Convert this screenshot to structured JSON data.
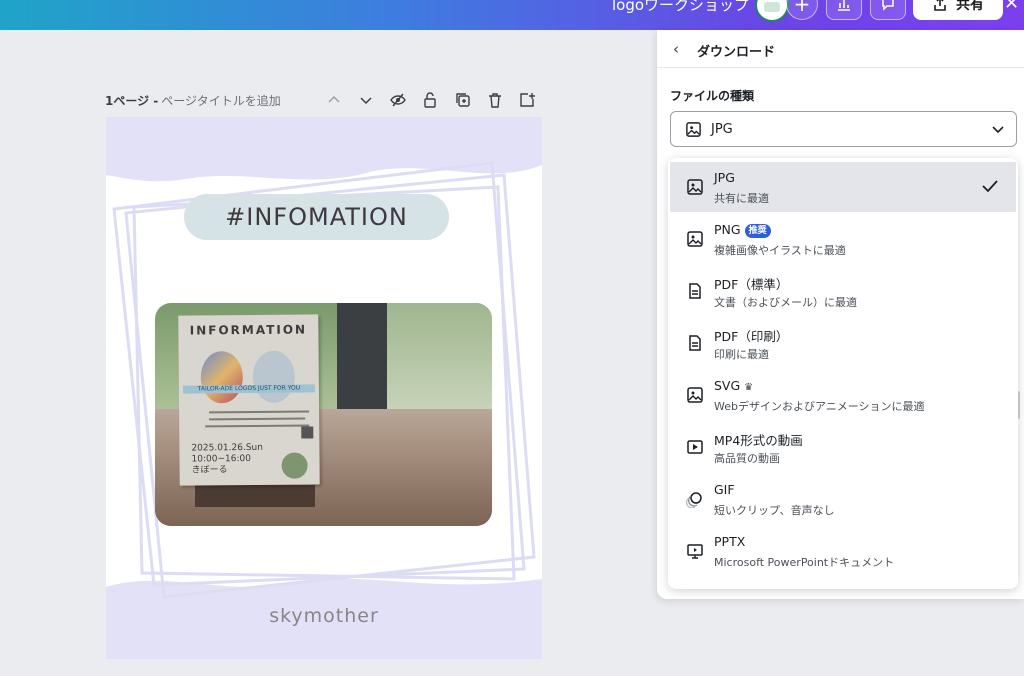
{
  "topbar": {
    "project_title": "logoワークショップ",
    "share_label": "共有"
  },
  "pagebar": {
    "page_label": "1ページ -",
    "title_placeholder": "ページタイトルを追加"
  },
  "canvas": {
    "heading": "#INFOMATION",
    "poster_heading": "INFORMATION",
    "poster_strip": "TAILOR-ADE LOGOS JUST FOR YOU",
    "poster_date": "2025.01.26.Sun",
    "poster_time": "10:00~16:00",
    "poster_place": "きぼーる",
    "brand": "skymother"
  },
  "panel": {
    "title": "ダウンロード",
    "file_type_label": "ファイルの種類",
    "selected_value": "JPG"
  },
  "options": [
    {
      "label": "JPG",
      "desc": "共有に最適",
      "icon": "image-icon"
    },
    {
      "label": "PNG",
      "badge": "推奨",
      "desc": "複雑画像やイラストに最適",
      "icon": "image-icon"
    },
    {
      "label": "PDF（標準）",
      "desc": "文書（およびメール）に最適",
      "icon": "document-icon"
    },
    {
      "label": "PDF（印刷）",
      "desc": "印刷に最適",
      "icon": "document-icon"
    },
    {
      "label": "SVG",
      "desc": "Webデザインおよびアニメーションに最適",
      "icon": "image-icon"
    },
    {
      "label": "MP4形式の動画",
      "desc": "高品質の動画",
      "icon": "video-icon"
    },
    {
      "label": "GIF",
      "desc": "短いクリップ、音声なし",
      "icon": "gif-icon"
    },
    {
      "label": "PPTX",
      "desc": "Microsoft PowerPointドキュメント",
      "icon": "presentation-icon"
    }
  ],
  "colors": {
    "topbar_start": "#1fa4c8",
    "topbar_end": "#7b3ff0",
    "accent": "#2f5fd8",
    "selected_row": "#e3e5ea"
  }
}
